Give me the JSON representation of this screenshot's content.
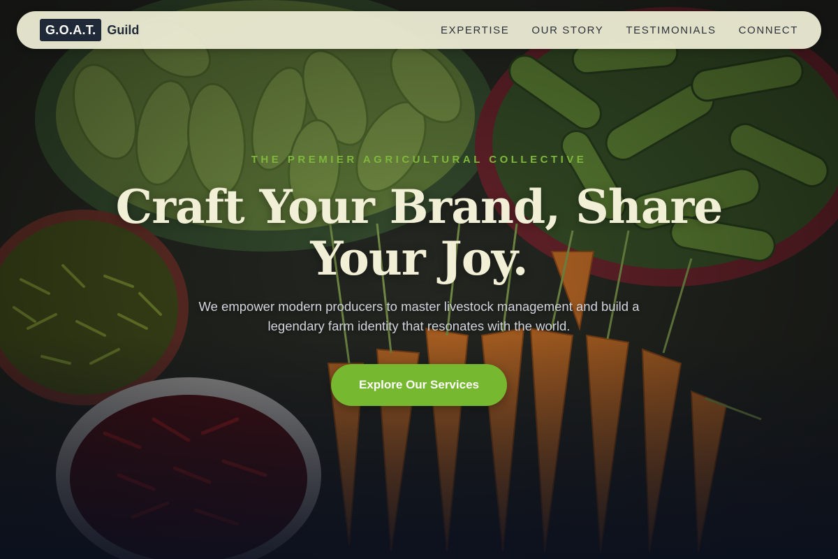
{
  "brand": {
    "logo_box_text": "G.O.A.T.",
    "logo_word": "Guild",
    "colors": {
      "dark": "#1f2937",
      "accent": "#76b82f",
      "nav_bg": "#ecebd4",
      "headline": "#f1efd6"
    }
  },
  "nav": {
    "links": [
      {
        "label": "EXPERTISE"
      },
      {
        "label": "OUR STORY"
      },
      {
        "label": "TESTIMONIALS"
      },
      {
        "label": "CONNECT"
      }
    ]
  },
  "hero": {
    "eyebrow": "THE PREMIER AGRICULTURAL COLLECTIVE",
    "headline": "Craft Your Brand, Share Your Joy.",
    "subtitle": "We empower modern producers to master livestock management and build a legendary farm identity that resonates with the world.",
    "cta_label": "Explore Our Services",
    "background_subject": "market vegetables: bitter gourds, cucumbers, green chilies, red chilies, carrots"
  }
}
